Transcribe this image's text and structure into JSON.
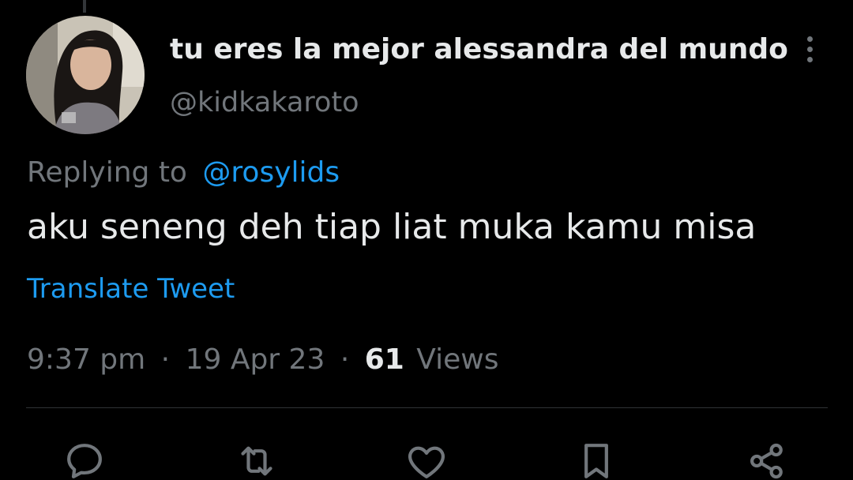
{
  "tweet": {
    "author": {
      "display_name": "tu eres la mejor alessandra del mundo",
      "handle": "@kidkakaroto"
    },
    "reply": {
      "prefix": "Replying to",
      "mention": "@rosylids"
    },
    "text": "aku seneng deh tiap liat muka kamu misa",
    "translate_label": "Translate Tweet",
    "meta": {
      "time": "9:37 pm",
      "separator": "·",
      "date": "19 Apr 23",
      "views_count": "61",
      "views_label": "Views"
    }
  },
  "actions": [
    {
      "icon": "reply-icon"
    },
    {
      "icon": "retweet-icon"
    },
    {
      "icon": "like-icon"
    },
    {
      "icon": "bookmark-icon"
    },
    {
      "icon": "share-icon"
    }
  ],
  "colors": {
    "background": "#000000",
    "primary_text": "#e7e9ea",
    "secondary_text": "#71767b",
    "accent": "#1d9bf0",
    "divider": "#2f3336"
  }
}
